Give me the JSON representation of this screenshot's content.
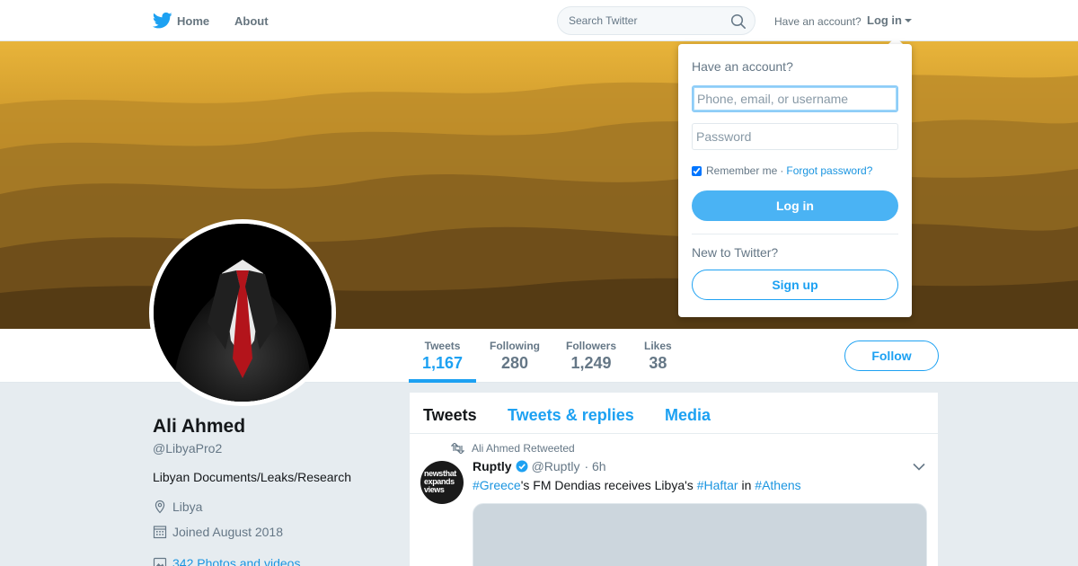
{
  "nav": {
    "home_label": "Home",
    "about_label": "About",
    "search_placeholder": "Search Twitter",
    "have_account": "Have an account?",
    "login_label": "Log in"
  },
  "profile": {
    "name": "Ali Ahmed",
    "handle": "@LibyaPro2",
    "bio": "Libyan Documents/Leaks/Research",
    "location": "Libya",
    "joined": "Joined August 2018",
    "photos": "342 Photos and videos"
  },
  "stats": [
    {
      "label": "Tweets",
      "value": "1,167",
      "active": true
    },
    {
      "label": "Following",
      "value": "280"
    },
    {
      "label": "Followers",
      "value": "1,249"
    },
    {
      "label": "Likes",
      "value": "38"
    }
  ],
  "follow_label": "Follow",
  "timeline": {
    "tabs": [
      "Tweets",
      "Tweets & replies",
      "Media"
    ],
    "tweet": {
      "retweeted_by": "Ali Ahmed Retweeted",
      "author_name": "Ruptly",
      "author_handle": "@Ruptly",
      "time": "· 6h",
      "avatar_text": [
        "news",
        "that",
        "expands",
        "views"
      ],
      "text_parts": [
        {
          "t": "#Greece",
          "tag": true
        },
        {
          "t": "'s FM Dendias receives Libya's ",
          "tag": false
        },
        {
          "t": "#Haftar",
          "tag": true
        },
        {
          "t": " in ",
          "tag": false
        },
        {
          "t": "#Athens",
          "tag": true
        }
      ]
    }
  },
  "login_dropdown": {
    "title": "Have an account?",
    "username_placeholder": "Phone, email, or username",
    "password_placeholder": "Password",
    "remember_label": "Remember me",
    "separator": "·",
    "forgot_label": "Forgot password?",
    "login_button": "Log in",
    "new_label": "New to Twitter?",
    "signup_button": "Sign up"
  },
  "colors": {
    "accent": "#1da1f2",
    "banner_sky": "#e0a832",
    "banner_dunes": "#7a5a24"
  }
}
